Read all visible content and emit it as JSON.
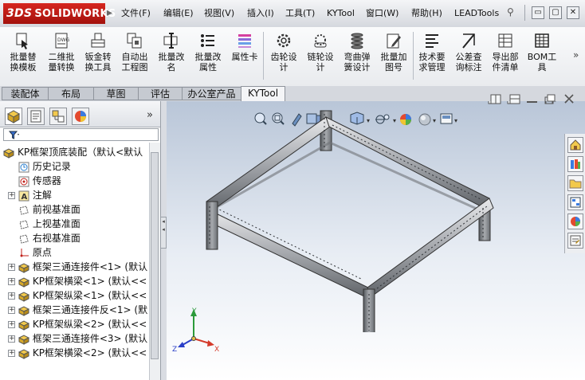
{
  "app": {
    "logo_prefix": "3DS",
    "logo_name": "SOLIDWORKS"
  },
  "menu": [
    {
      "label": "文件(F)"
    },
    {
      "label": "编辑(E)"
    },
    {
      "label": "视图(V)"
    },
    {
      "label": "插入(I)"
    },
    {
      "label": "工具(T)"
    },
    {
      "label": "KYTool"
    },
    {
      "label": "窗口(W)"
    },
    {
      "label": "帮助(H)"
    },
    {
      "label": "LEADTools"
    }
  ],
  "toolbar": [
    {
      "label": "批量替\n换模板",
      "icon": "template-replace-icon"
    },
    {
      "label": "二维批\n量转换",
      "icon": "batch-convert-icon"
    },
    {
      "label": "钣金转\n换工具",
      "icon": "sheetmetal-icon"
    },
    {
      "label": "自动出\n工程图",
      "icon": "auto-drawing-icon"
    },
    {
      "label": "批量改\n名",
      "icon": "batch-rename-icon"
    },
    {
      "label": "批量改\n属性",
      "icon": "batch-property-icon"
    },
    {
      "label": "属性卡",
      "icon": "property-card-icon"
    },
    {
      "label": "齿轮设\n计",
      "icon": "gear-design-icon"
    },
    {
      "label": "链轮设\n计",
      "icon": "sprocket-icon"
    },
    {
      "label": "弯曲弹\n簧设计",
      "icon": "spring-icon"
    },
    {
      "label": "批量加\n图号",
      "icon": "drawing-number-icon"
    },
    {
      "label": "技术要\n求管理",
      "icon": "tech-requirements-icon"
    },
    {
      "label": "公差查\n询标注",
      "icon": "tolerance-icon"
    },
    {
      "label": "导出部\n件清单",
      "icon": "export-bom-icon"
    },
    {
      "label": "BOM工\n具",
      "icon": "bom-tool-icon"
    }
  ],
  "toolbar_more": "»",
  "tabs": [
    {
      "label": "装配体"
    },
    {
      "label": "布局"
    },
    {
      "label": "草图"
    },
    {
      "label": "评估"
    },
    {
      "label": "办公室产品"
    },
    {
      "label": "KYTool",
      "active": true
    }
  ],
  "panel_more": "»",
  "tree": {
    "root": "KP框架顶底装配（默认<默认",
    "items": [
      {
        "label": "历史记录",
        "icon": "history-icon",
        "expand": ""
      },
      {
        "label": "传感器",
        "icon": "sensor-icon",
        "expand": ""
      },
      {
        "label": "注解",
        "icon": "annotation-icon",
        "expand": "+"
      },
      {
        "label": "前视基准面",
        "icon": "plane-icon",
        "expand": ""
      },
      {
        "label": "上视基准面",
        "icon": "plane-icon",
        "expand": ""
      },
      {
        "label": "右视基准面",
        "icon": "plane-icon",
        "expand": ""
      },
      {
        "label": "原点",
        "icon": "origin-icon",
        "expand": ""
      },
      {
        "label": "框架三通连接件<1> (默认",
        "icon": "part-icon",
        "expand": "+"
      },
      {
        "label": "KP框架横梁<1> (默认<<",
        "icon": "part-icon",
        "expand": "+"
      },
      {
        "label": "KP框架纵梁<1> (默认<<",
        "icon": "part-icon",
        "expand": "+"
      },
      {
        "label": "框架三通连接件反<1> (默",
        "icon": "part-icon",
        "expand": "+"
      },
      {
        "label": "KP框架纵梁<2> (默认<<",
        "icon": "part-icon",
        "expand": "+"
      },
      {
        "label": "框架三通连接件<3> (默认",
        "icon": "part-icon",
        "expand": "+"
      },
      {
        "label": "KP框架横梁<2> (默认<<",
        "icon": "part-icon",
        "expand": "+"
      }
    ]
  },
  "triad": {
    "x": "X",
    "y": "Y",
    "z": "Z"
  },
  "colors": {
    "accent": "#c0201a",
    "x_axis": "#d43a2a",
    "y_axis": "#2b9a3a",
    "z_axis": "#2a3fc8"
  }
}
